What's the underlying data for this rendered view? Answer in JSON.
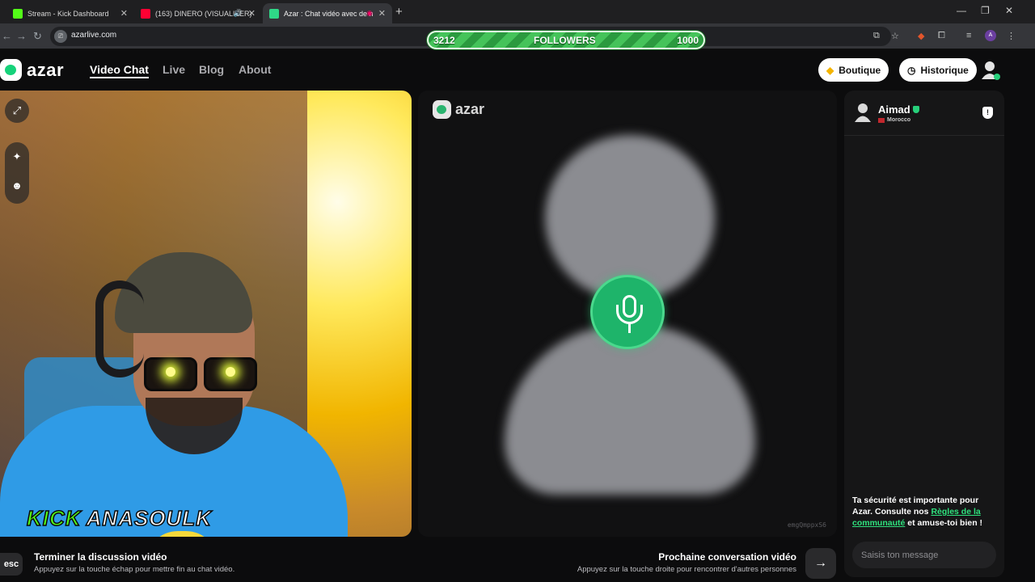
{
  "browser": {
    "tabs": [
      {
        "title": "Stream - Kick Dashboard",
        "favicon_color": "#53fc18"
      },
      {
        "title": "(163) DINERO (VISUALIZER)",
        "favicon_color": "#ff0033"
      },
      {
        "title": "Azar : Chat vidéo avec de n",
        "favicon_color": "#2fd887"
      }
    ],
    "new_tab_label": "+",
    "url": "azarlive.com",
    "profile_initial": "A"
  },
  "stream_overlay": {
    "followers_current": "3212",
    "followers_label": "FOLLOWERS",
    "followers_goal": "1000",
    "streamer_platform": "KICK",
    "streamer_name": "ANASOULK"
  },
  "site": {
    "brand": "azar",
    "nav": [
      {
        "label": "Video Chat",
        "active": true
      },
      {
        "label": "Live",
        "active": false
      },
      {
        "label": "Blog",
        "active": false
      },
      {
        "label": "About",
        "active": false
      }
    ],
    "boutique_label": "Boutique",
    "historique_label": "Historique",
    "accent_color": "#1eb46a"
  },
  "partner": {
    "name": "Aimad",
    "country": "Morocco",
    "session_id": "emgQmppxS6"
  },
  "chat": {
    "safety_text_1": "Ta sécurité est importante pour Azar. Consulte nos ",
    "safety_link": "Règles de la communauté",
    "safety_text_2": " et amuse-toi bien !",
    "input_placeholder": "Saisis ton message"
  },
  "controls": {
    "esc_key": "esc",
    "end_title": "Terminer la discussion vidéo",
    "end_sub": "Appuyez sur la touche échap pour mettre fin au chat vidéo.",
    "next_title": "Prochaine conversation vidéo",
    "next_sub": "Appuyez sur la touche droite pour rencontrer d'autres personnes"
  }
}
